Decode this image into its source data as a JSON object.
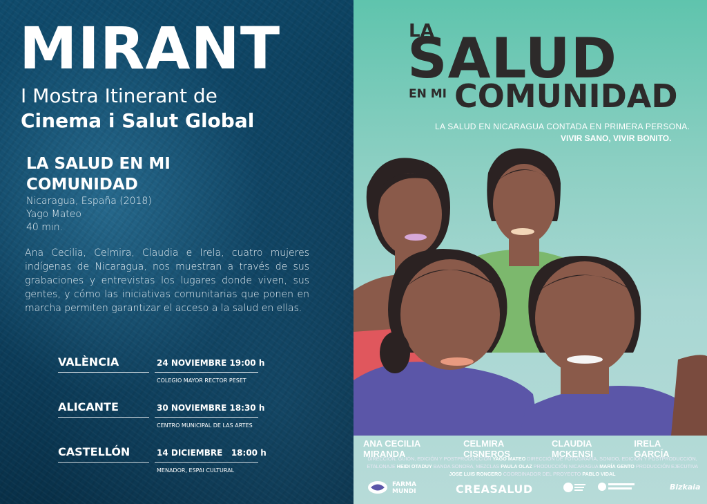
{
  "left": {
    "brand": "MIRANT",
    "subtitle_line1": "I Mostra Itinerant de",
    "subtitle_line2": "Cinema i Salut Global",
    "film_title": "LA SALUD EN MI COMUNIDAD",
    "meta": [
      "Nicaragua, España (2018)",
      "Yago Mateo",
      "40 min."
    ],
    "synopsis": "Ana Cecilia, Celmira, Claudia e Irela, cuatro mujeres indígenas de Nicaragua, nos muestran a través de sus grabaciones y entrevistas los lugares donde viven, sus gentes, y cómo las iniciativas comunitarias que ponen en marcha permiten garantizar el acceso a la salud en ellas.",
    "screenings": [
      {
        "city": "VALÈNCIA",
        "date": "24 NOVIEMBRE 19:00 h",
        "venue": "COLEGIO MAYOR RECTOR PESET"
      },
      {
        "city": "ALICANTE",
        "date": "30 NOVIEMBRE 18:30 h",
        "venue": "CENTRO MUNICIPAL DE LAS ARTES"
      },
      {
        "city": "CASTELLÓN",
        "date": "14 DICIEMBRE   18:00 h",
        "venue": "MENADOR, ESPAI CULTURAL"
      }
    ]
  },
  "poster": {
    "title_la": "LA",
    "title_salud": "SALUD",
    "title_en_mi": "EN MI",
    "title_comunidad": "COMUNIDAD",
    "tagline": "LA SALUD EN NICARAGUA CONTADA EN PRIMERA PERSONA.",
    "tagline2": "VIVIR SANO, VIVIR BONITO.",
    "cast": [
      "ANA CECILIA MIRANDA",
      "CELMIRA CISNEROS",
      "CLAUDIA MCKENSI",
      "IRELA GARCÍA"
    ],
    "credits": [
      {
        "role": "DIRECCIÓN, GUIÓN, EDICIÓN Y POSTPRODUCCIÓN",
        "name": "YAGO MATEO"
      },
      {
        "role": "DIRECCIÓN DE FOTOGRAFÍA, SONIDO, EDICIÓN Y POSTPRODUCCIÓN, ETALONAJE",
        "name": "HEIDI OTADUY"
      },
      {
        "role": "BANDA SONORA, MEZCLAS",
        "name": "PAULA OLAZ"
      },
      {
        "role": "PRODUCCIÓN NICARAGUA",
        "name": "MARÍA GENTO"
      },
      {
        "role": "PRODUCCIÓN EJECUTIVA",
        "name": "JOSE LUIS RONCERO"
      },
      {
        "role": "COORDINADOR DEL PROYECTO",
        "name": "PABLO VIDAL"
      }
    ],
    "logos": {
      "farmamundi": "FARMA MUNDI",
      "creasalud": "CREASALUD",
      "bizkaia": "Bizkaia"
    },
    "colors": {
      "poster_bg_top": "#5fc4ad",
      "skin": "#8a5a4a",
      "hair": "#2b2222",
      "shirt_purple": "#5b56a8",
      "shirt_red": "#e0575d",
      "shirt_green": "#7cb86d"
    }
  }
}
